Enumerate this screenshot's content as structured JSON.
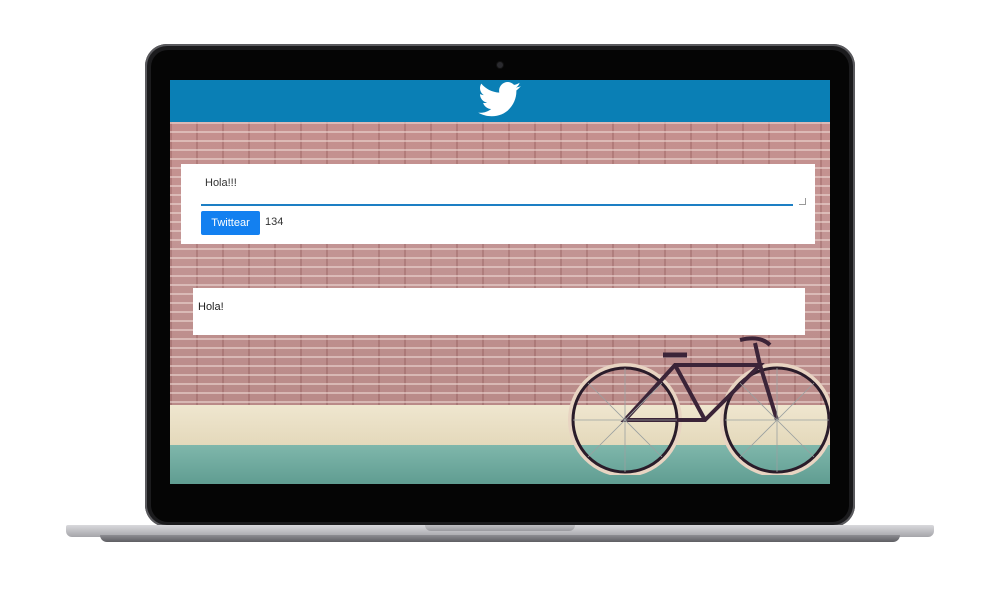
{
  "app": {
    "logo_icon": "twitter-bird-icon",
    "header_color": "#0a7fb5"
  },
  "compose": {
    "text": "Hola!!!",
    "button_label": "Twittear",
    "counter": "134",
    "button_color": "#1380f0"
  },
  "feed": {
    "tweets": [
      {
        "text": "Hola!"
      }
    ]
  }
}
